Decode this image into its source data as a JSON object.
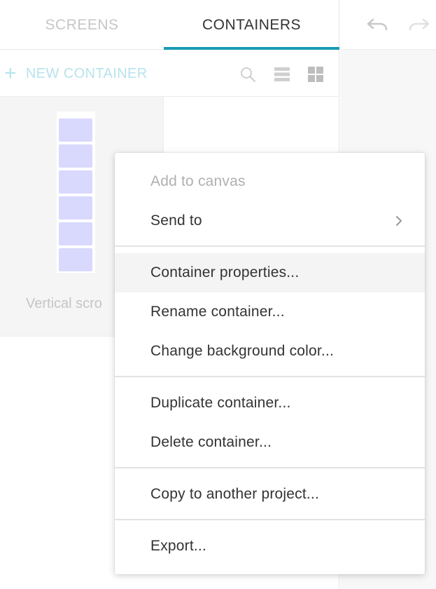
{
  "tabs": [
    {
      "label": "SCREENS",
      "active": false
    },
    {
      "label": "CONTAINERS",
      "active": true
    }
  ],
  "toolbar": {
    "new_container_label": "NEW CONTAINER",
    "icons": [
      "search-icon",
      "list-view-icon",
      "grid-view-icon"
    ]
  },
  "tile": {
    "label": "Vertical scro",
    "thumb_color": "#d9d8fd"
  },
  "history": {
    "icons": [
      "undo-icon",
      "redo-icon"
    ]
  },
  "context_menu": {
    "items": [
      {
        "label": "Add to canvas",
        "disabled": true
      },
      {
        "label": "Send to",
        "has_submenu": true
      },
      {
        "label": "Container properties...",
        "highlighted": true
      },
      {
        "label": "Rename container..."
      },
      {
        "label": "Change background color..."
      },
      {
        "label": "Duplicate container..."
      },
      {
        "label": "Delete container..."
      },
      {
        "label": "Copy to another project..."
      },
      {
        "label": "Export..."
      }
    ]
  },
  "colors": {
    "accent": "#1a9bb3",
    "accent_light": "#b7e3ec"
  }
}
